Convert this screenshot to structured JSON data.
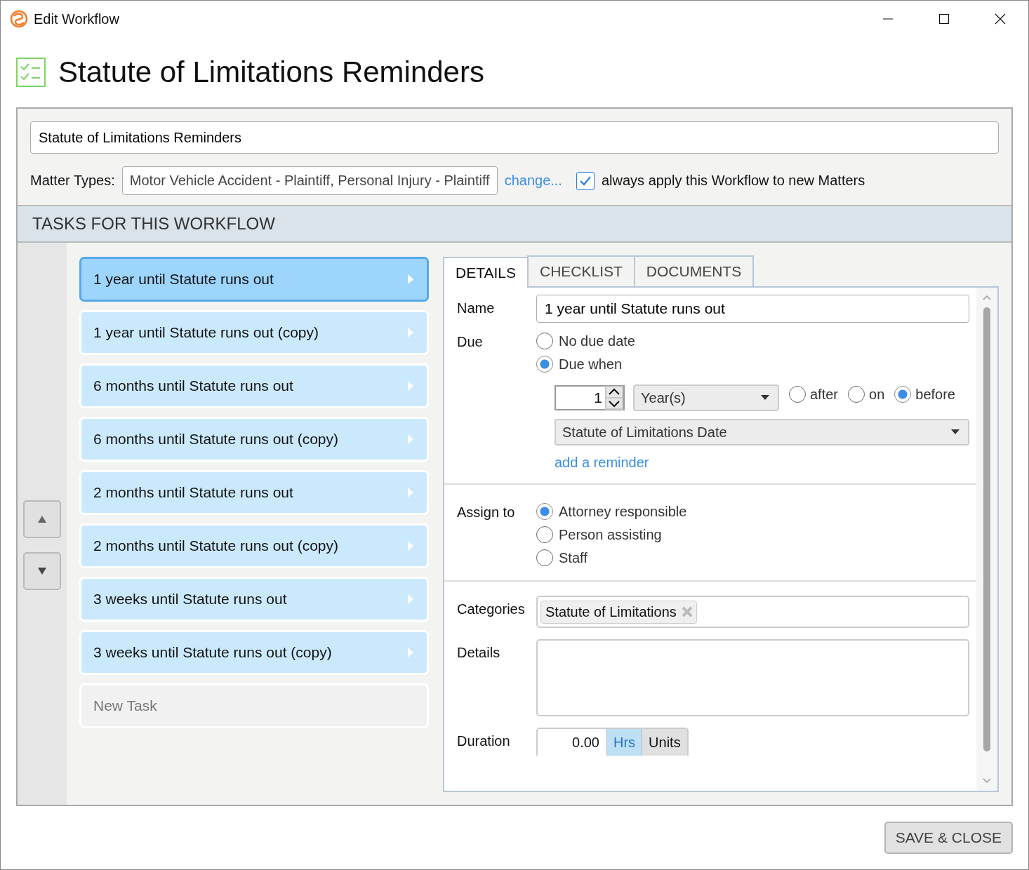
{
  "window": {
    "title": "Edit Workflow"
  },
  "header": {
    "title": "Statute of Limitations Reminders"
  },
  "workflow_name": {
    "value": "Statute of Limitations Reminders"
  },
  "matter_types": {
    "label": "Matter Types:",
    "value": "Motor Vehicle Accident - Plaintiff, Personal Injury - Plaintiff",
    "change_link": "change...",
    "always_apply": {
      "label": "always apply this Workflow to new Matters",
      "checked": true
    }
  },
  "section_title": "TASKS FOR THIS WORKFLOW",
  "tasks": [
    {
      "label": "1 year until Statute runs out",
      "selected": true
    },
    {
      "label": "1 year until Statute runs out (copy)",
      "selected": false
    },
    {
      "label": "6 months until Statute runs out",
      "selected": false
    },
    {
      "label": "6 months until Statute runs out (copy)",
      "selected": false
    },
    {
      "label": "2 months until Statute runs out",
      "selected": false
    },
    {
      "label": "2 months until Statute runs out (copy)",
      "selected": false
    },
    {
      "label": "3 weeks until Statute runs out",
      "selected": false
    },
    {
      "label": "3 weeks until Statute runs out (copy)",
      "selected": false
    }
  ],
  "new_task": {
    "placeholder": "New Task"
  },
  "tabs": [
    {
      "label": "DETAILS",
      "selected": true
    },
    {
      "label": "CHECKLIST",
      "selected": false
    },
    {
      "label": "DOCUMENTS",
      "selected": false
    }
  ],
  "details": {
    "name": {
      "label": "Name",
      "value": "1 year until Statute runs out"
    },
    "due": {
      "label": "Due",
      "options": [
        {
          "label": "No due date",
          "selected": false
        },
        {
          "label": "Due when",
          "selected": true
        }
      ],
      "interval": "1",
      "unit": "Year(s)",
      "relation": [
        {
          "label": "after",
          "selected": false
        },
        {
          "label": "on",
          "selected": false
        },
        {
          "label": "before",
          "selected": true
        }
      ],
      "date_field": "Statute of Limitations Date",
      "add_reminder": "add a reminder"
    },
    "assign_to": {
      "label": "Assign to",
      "options": [
        {
          "label": "Attorney responsible",
          "selected": true
        },
        {
          "label": "Person assisting",
          "selected": false
        },
        {
          "label": "Staff",
          "selected": false
        }
      ]
    },
    "categories": {
      "label": "Categories",
      "tags": [
        {
          "label": "Statute of Limitations"
        }
      ]
    },
    "details_field": {
      "label": "Details"
    },
    "duration": {
      "label": "Duration",
      "value": "0.00",
      "units": [
        {
          "label": "Hrs",
          "selected": true
        },
        {
          "label": "Units",
          "selected": false
        }
      ]
    }
  },
  "save_button": "SAVE & CLOSE"
}
